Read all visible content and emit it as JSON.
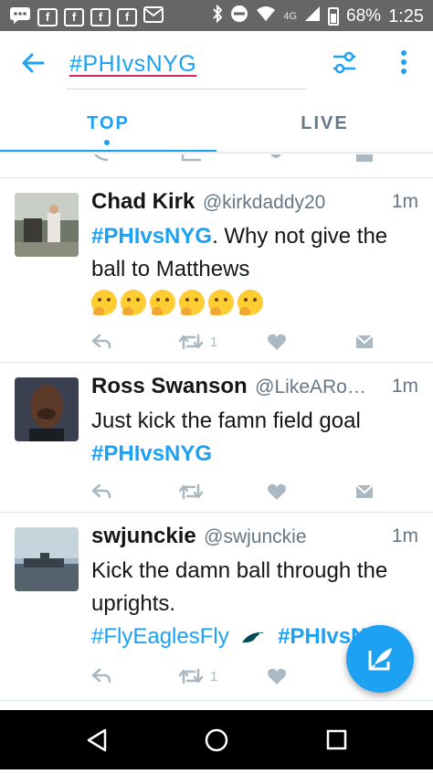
{
  "status_bar": {
    "network": "4G",
    "battery_percent": "68%",
    "time": "1:25"
  },
  "app_bar": {
    "search_query": "#PHIvsNYG"
  },
  "tabs": [
    {
      "label": "TOP",
      "selected": true
    },
    {
      "label": "LIVE",
      "selected": false
    }
  ],
  "tweets": [
    {
      "name": "Chad Kirk",
      "handle": "@kirkdaddy20",
      "time": "1m",
      "hashtag": "#PHIvsNYG",
      "text": ". Why not give the ball to Matthews",
      "emoji_count": 6,
      "retweet_count": "1"
    },
    {
      "name": "Ross Swanson",
      "handle": "@LikeARo…",
      "time": "1m",
      "text": "Just kick the famn field goal",
      "hashtag": "#PHIvsNYG",
      "retweet_count": ""
    },
    {
      "name": "swjunckie",
      "handle": "@swjunckie",
      "time": "1m",
      "text": "Kick the damn ball through the uprights.",
      "hashtag1": "#FlyEaglesFly",
      "hashtag2": "#PHIvsNYG",
      "retweet_count": "1"
    }
  ],
  "colors": {
    "accent": "#1da1f2",
    "text": "#14171a",
    "secondary": "#657786",
    "action_icons": "#aab8c2",
    "status_bar": "#666666"
  }
}
